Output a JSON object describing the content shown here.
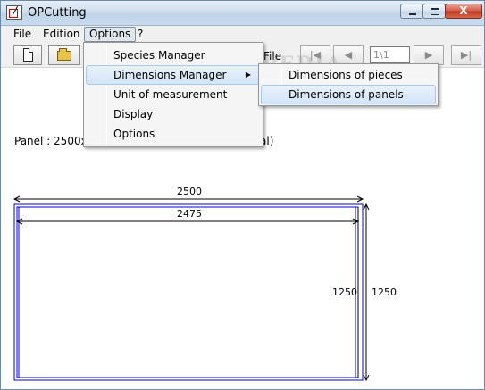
{
  "window": {
    "title": "OPCutting"
  },
  "titlebar_buttons": {
    "minimize": "",
    "maximize": "",
    "close": "X"
  },
  "menubar": {
    "file": "File",
    "edition": "Edition",
    "options": "Options",
    "help": "?"
  },
  "toolbar": {
    "file_label": "File",
    "page_value": "1\\1",
    "nav_first": "|◀",
    "nav_prev": "◀",
    "nav_next": "▶",
    "nav_last": "▶|"
  },
  "options_menu": {
    "items": [
      "Species Manager",
      "Dimensions Manager",
      "Unit of measurement",
      "Display",
      "Options"
    ],
    "submenu_arrow": "▶"
  },
  "dimensions_submenu": {
    "items": [
      "Dimensions of pieces",
      "Dimensions of panels"
    ]
  },
  "content": {
    "panel_text_start": "Panel : 2500x12",
    "panel_text_end": "al)"
  },
  "drawing": {
    "outer_width": "2500",
    "inner_width": "2475",
    "inner_height": "1250",
    "outer_height": "1250"
  },
  "watermark": "SOFTPEDIA",
  "colors": {
    "panel_line": "#0000cc",
    "dimension_line": "#000000"
  }
}
